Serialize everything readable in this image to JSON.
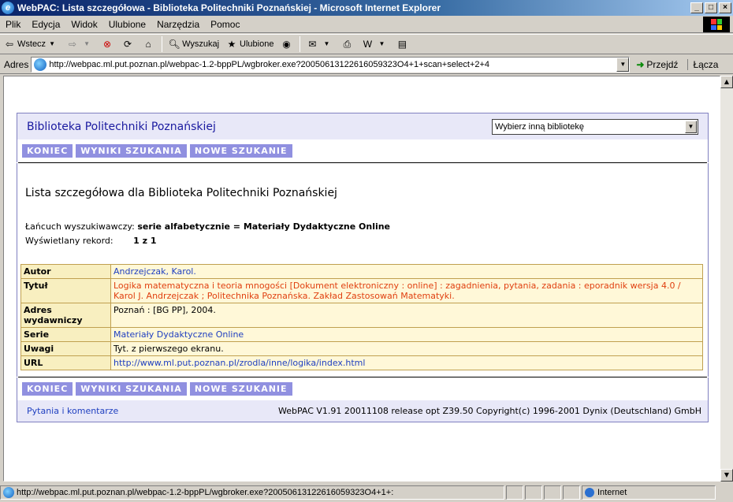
{
  "window": {
    "title": "WebPAC: Lista szczegółowa - Biblioteka Politechniki Poznańskiej - Microsoft Internet Explorer",
    "minimize": "_",
    "maximize": "□",
    "close": "×"
  },
  "menu": {
    "items": [
      "Plik",
      "Edycja",
      "Widok",
      "Ulubione",
      "Narzędzia",
      "Pomoc"
    ]
  },
  "toolbar": {
    "back": "Wstecz",
    "search": "Wyszukaj",
    "favorites": "Ulubione"
  },
  "address": {
    "label": "Adres",
    "url": "http://webpac.ml.put.poznan.pl/webpac-1.2-bppPL/wgbroker.exe?20050613122616059323O4+1+scan+select+2+4",
    "go": "Przejdź",
    "links": "Łącza"
  },
  "page": {
    "library_name": "Biblioteka Politechniki Poznańskiej",
    "library_select": "Wybierz inną bibliotekę",
    "nav": [
      "KONIEC",
      "WYNIKI SZUKANIA",
      "NOWE SZUKANIE"
    ],
    "list_title": "Lista szczegółowa dla Biblioteka Politechniki Poznańskiej",
    "search_chain_label": "Łańcuch wyszukiwawczy:",
    "search_chain_value": "serie alfabetycznie = Materiały Dydaktyczne Online",
    "record_label": "Wyświetlany rekord:",
    "record_value": "1 z 1",
    "record": {
      "author_label": "Autor",
      "author": "Andrzejczak, Karol.",
      "title_label": "Tytuł",
      "title": "Logika matematyczna i teoria mnogości [Dokument elektroniczny : online] : zagadnienia, pytania, zadania : eporadnik wersja 4.0 / Karol J. Andrzejczak ; Politechnika Poznańska. Zakład Zastosowań Matematyki.",
      "publisher_label": "Adres wydawniczy",
      "publisher": "Poznań : [BG PP], 2004.",
      "series_label": "Serie",
      "series": "Materiały Dydaktyczne Online",
      "notes_label": "Uwagi",
      "notes": "Tyt. z pierwszego ekranu.",
      "url_label": "URL",
      "url": "http://www.ml.put.poznan.pl/zrodla/inne/logika/index.html"
    },
    "footer_link": "Pytania i komentarze",
    "footer_copyright": "WebPAC V1.91 20011108 release opt Z39.50 Copyright(c) 1996-2001 Dynix (Deutschland) GmbH"
  },
  "status": {
    "url": "http://webpac.ml.put.poznan.pl/webpac-1.2-bppPL/wgbroker.exe?20050613122616059323O4+1+:",
    "zone": "Internet"
  }
}
